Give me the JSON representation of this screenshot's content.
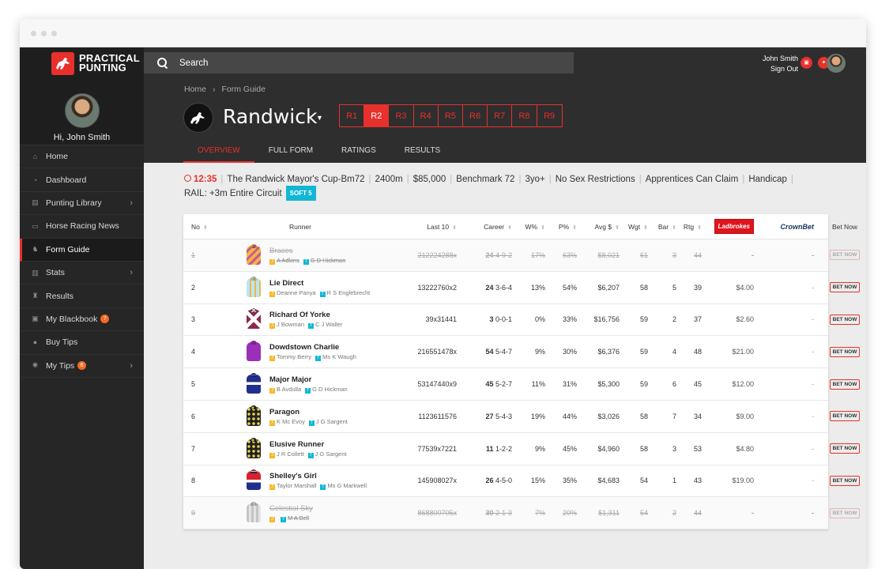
{
  "brand": {
    "line1": "PRACTICAL",
    "line2": "PUNTING",
    "accent": "#e8302c"
  },
  "profile": {
    "greeting": "Hi, John Smith"
  },
  "sidebar": {
    "items": [
      {
        "label": "Home",
        "icon": "home-icon"
      },
      {
        "label": "Dashboard",
        "icon": "dashboard-icon"
      },
      {
        "label": "Punting Library",
        "icon": "book-icon",
        "chevron": true
      },
      {
        "label": "Horse Racing News",
        "icon": "news-icon"
      },
      {
        "label": "Form Guide",
        "icon": "horse-icon",
        "active": true
      },
      {
        "label": "Stats",
        "icon": "stats-icon",
        "chevron": true
      },
      {
        "label": "Results",
        "icon": "trophy-icon"
      },
      {
        "label": "My Blackbook",
        "icon": "blackbook-icon",
        "badge": "7"
      },
      {
        "label": "Buy Tips",
        "icon": "tips-icon"
      },
      {
        "label": "My Tips",
        "icon": "bulb-icon",
        "badge": "6",
        "chevron": true
      }
    ]
  },
  "search": {
    "placeholder": "Search"
  },
  "user": {
    "name": "John Smith",
    "signout": "Sign Out"
  },
  "breadcrumb": {
    "home": "Home",
    "current": "Form Guide"
  },
  "venue": {
    "name": "Randwick"
  },
  "races": [
    "R1",
    "R2",
    "R3",
    "R4",
    "R5",
    "R6",
    "R7",
    "R8",
    "R9"
  ],
  "selected_race": "R2",
  "tabs": [
    "OVERVIEW",
    "FULL FORM",
    "RATINGS",
    "RESULTS"
  ],
  "race_info": {
    "time": "12:35",
    "name": "The Randwick Mayor's Cup-Bm72",
    "distance": "2400m",
    "prize": "$85,000",
    "class": "Benchmark 72",
    "age": "3yo+",
    "sex": "No Sex Restrictions",
    "apprentices": "Apprentices Can Claim",
    "type": "Handicap",
    "rail": "RAIL: +3m Entire Circuit",
    "track": "SOFT 5"
  },
  "table": {
    "headers": {
      "no": "No",
      "runner": "Runner",
      "last10": "Last 10",
      "career": "Career",
      "w": "W%",
      "p": "P%",
      "avg": "Avg $",
      "wgt": "Wgt",
      "bar": "Bar",
      "rtg": "Rtg",
      "ladbrokes": "Ladbrokes",
      "crownbet": "CrownBet",
      "bet": "Bet Now"
    },
    "bet_label": "BET NOW",
    "rows": [
      {
        "no": "1",
        "name": "Braces",
        "jockey": "A Adkins",
        "trainer": "G D Hickman",
        "last10": "212224288x",
        "career_w": "24",
        "career_rest": "4-9-2",
        "w": "17%",
        "p": "63%",
        "avg": "$8,021",
        "wgt": "61",
        "bar": "3",
        "rtg": "44",
        "lad": "-",
        "crown": "-",
        "scratched": true,
        "silk": "#e9b94a"
      },
      {
        "no": "2",
        "name": "Lie Direct",
        "jockey": "Deanne Panya",
        "trainer": "R S Englebrecht",
        "last10": "13222760x2",
        "career_w": "24",
        "career_rest": "3-6-4",
        "w": "13%",
        "p": "54%",
        "avg": "$6,207",
        "wgt": "58",
        "bar": "5",
        "rtg": "39",
        "lad": "$4.00",
        "crown": "-",
        "scratched": false,
        "silk": "#9bd3e8"
      },
      {
        "no": "3",
        "name": "Richard Of Yorke",
        "jockey": "J Bowman",
        "trainer": "C J Waller",
        "last10": "39x31441",
        "career_w": "3",
        "career_rest": "0-0-1",
        "w": "0%",
        "p": "33%",
        "avg": "$16,756",
        "wgt": "59",
        "bar": "2",
        "rtg": "37",
        "lad": "$2.60",
        "crown": "-",
        "scratched": false,
        "silk": "#8c2a4a"
      },
      {
        "no": "4",
        "name": "Dowdstown Charlie",
        "jockey": "Tommy Berry",
        "trainer": "Ms K Waugh",
        "last10": "216551478x",
        "career_w": "54",
        "career_rest": "5-4-7",
        "w": "9%",
        "p": "30%",
        "avg": "$6,376",
        "wgt": "59",
        "bar": "4",
        "rtg": "48",
        "lad": "$21.00",
        "crown": "-",
        "scratched": false,
        "silk": "#9b2fb8"
      },
      {
        "no": "5",
        "name": "Major Major",
        "jockey": "B Avdulla",
        "trainer": "G D Hickman",
        "last10": "53147440x9",
        "career_w": "45",
        "career_rest": "5-2-7",
        "w": "11%",
        "p": "31%",
        "avg": "$5,300",
        "wgt": "59",
        "bar": "6",
        "rtg": "45",
        "lad": "$12.00",
        "crown": "-",
        "scratched": false,
        "silk": "#1f2f8c"
      },
      {
        "no": "6",
        "name": "Paragon",
        "jockey": "K Mc Evoy",
        "trainer": "J G Sargent",
        "last10": "1123611576",
        "career_w": "27",
        "career_rest": "5-4-3",
        "w": "19%",
        "p": "44%",
        "avg": "$3,026",
        "wgt": "58",
        "bar": "7",
        "rtg": "34",
        "lad": "$9.00",
        "crown": "-",
        "scratched": false,
        "silk": "#222222"
      },
      {
        "no": "7",
        "name": "Elusive Runner",
        "jockey": "J R Collett",
        "trainer": "J G Sargent",
        "last10": "77539x7221",
        "career_w": "11",
        "career_rest": "1-2-2",
        "w": "9%",
        "p": "45%",
        "avg": "$4,960",
        "wgt": "58",
        "bar": "3",
        "rtg": "53",
        "lad": "$4.80",
        "crown": "-",
        "scratched": false,
        "silk": "#222222"
      },
      {
        "no": "8",
        "name": "Shelley's Girl",
        "jockey": "Taylor Marshall",
        "trainer": "Ms G Markwell",
        "last10": "145908027x",
        "career_w": "26",
        "career_rest": "4-5-0",
        "w": "15%",
        "p": "35%",
        "avg": "$4,683",
        "wgt": "54",
        "bar": "1",
        "rtg": "43",
        "lad": "$19.00",
        "crown": "-",
        "scratched": false,
        "silk": "#d8232a"
      },
      {
        "no": "9",
        "name": "Celestial Sky",
        "jockey": "",
        "trainer": "M A Bell",
        "last10": "868800705x",
        "career_w": "30",
        "career_rest": "2-1-3",
        "w": "7%",
        "p": "20%",
        "avg": "$1,311",
        "wgt": "54",
        "bar": "2",
        "rtg": "44",
        "lad": "-",
        "crown": "-",
        "scratched": true,
        "silk": "#b5b5b5"
      }
    ]
  }
}
